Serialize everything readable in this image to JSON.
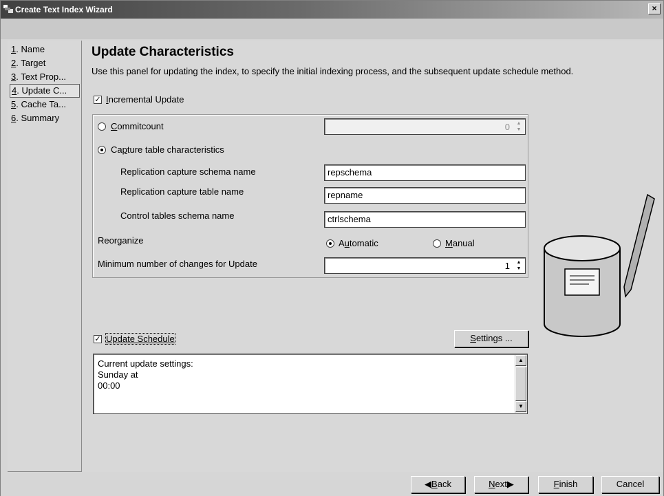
{
  "window": {
    "title": "Create Text Index Wizard",
    "close_label": "×"
  },
  "nav": {
    "items": [
      {
        "num": "1",
        "label": ". Name"
      },
      {
        "num": "2",
        "label": ". Target"
      },
      {
        "num": "3",
        "label": ". Text Prop..."
      },
      {
        "num": "4",
        "label": ". Update C..."
      },
      {
        "num": "5",
        "label": ". Cache Ta..."
      },
      {
        "num": "6",
        "label": ". Summary"
      }
    ],
    "selected_index": 3
  },
  "panel": {
    "title": "Update Characteristics",
    "description": "Use this panel for updating the index, to specify the initial indexing process, and the subsequent update schedule method.",
    "incremental_update": {
      "checked": true,
      "mnemonic": "I",
      "label_rest": "ncremental Update"
    },
    "commitcount": {
      "selected": false,
      "mnemonic": "C",
      "label_rest": "ommitcount",
      "value": "0"
    },
    "capture": {
      "selected": true,
      "label_pre": "Ca",
      "mnemonic": "p",
      "label_rest": "ture table characteristics"
    },
    "capture_schema": {
      "label": "Replication capture schema name",
      "value": "repschema"
    },
    "capture_table": {
      "label": "Replication capture table name",
      "value": "repname"
    },
    "control_schema": {
      "label": "Control tables schema name",
      "value": "ctrlschema"
    },
    "reorganize": {
      "label": "Reorganize",
      "automatic": {
        "selected": true,
        "pre": "A",
        "mnemonic": "u",
        "rest": "tomatic"
      },
      "manual": {
        "selected": false,
        "mnemonic": "M",
        "rest": "anual"
      }
    },
    "min_changes": {
      "label": "Minimum number of changes for Update",
      "value": "1"
    },
    "update_schedule": {
      "checked": true,
      "label": "Update Schedule"
    },
    "settings_button": {
      "mnemonic": "S",
      "rest": "ettings ..."
    },
    "current_settings": {
      "lines": [
        "Current update settings:",
        "Sunday at",
        "00:00"
      ]
    }
  },
  "buttons": {
    "back": {
      "mnemonic": "B",
      "rest": "ack"
    },
    "next": {
      "mnemonic": "N",
      "rest": "ext"
    },
    "finish": {
      "mnemonic": "F",
      "rest": "inish"
    },
    "cancel": {
      "label": "Cancel"
    }
  }
}
